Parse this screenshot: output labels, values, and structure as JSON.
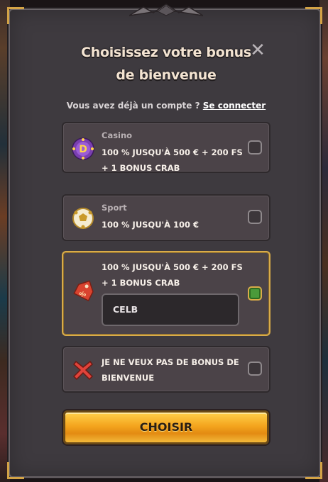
{
  "modal": {
    "title_line1": "Choisissez votre bonus",
    "title_line2": "de bienvenue",
    "close_glyph": "✕",
    "login_prompt": "Vous avez déjà un compte ?",
    "login_link": "Se connecter"
  },
  "options": [
    {
      "category": "Casino",
      "line1": "100 % JUSQU'À 500 € + 200 FS",
      "line2": "+ 1 BONUS CRAB",
      "icon": "casino-chip-icon",
      "checked": false
    },
    {
      "category": "Sport",
      "line1": "100 % JUSQU'À 100 €",
      "line2": "",
      "icon": "soccer-ball-icon",
      "checked": false
    },
    {
      "category": "",
      "line1": "100 % JUSQU'À 500 € + 200 FS",
      "line2": "+ 1 BONUS CRAB",
      "icon": "promo-tag-icon",
      "checked": true,
      "promo_code": "CELB"
    },
    {
      "category": "",
      "line1": "JE NE VEUX PAS DE BONUS DE",
      "line2": "BIENVENUE",
      "icon": "red-x-icon",
      "checked": false
    }
  ],
  "cta": {
    "label": "CHOISIR"
  },
  "colors": {
    "accent_gold": "#d9ac4a",
    "panel": "#3e3a3f",
    "option_bg": "#4b4348",
    "checked_green": "#4a9a3a",
    "cta_orange": "#f4a51e"
  }
}
